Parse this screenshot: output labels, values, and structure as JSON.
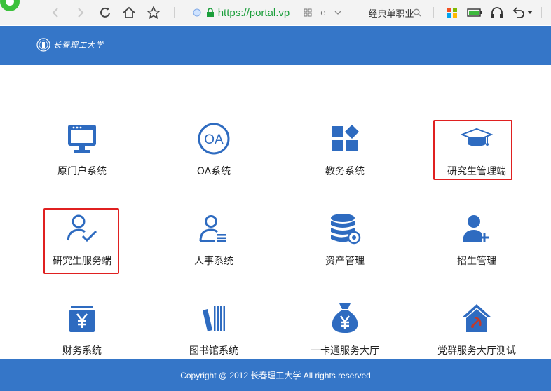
{
  "browser": {
    "url": "https://portal.vp",
    "search_text": "经典单职业"
  },
  "header": {
    "brand_name": "长春理工大学"
  },
  "tiles": [
    {
      "label": "原门户系统",
      "icon": "monitor-icon"
    },
    {
      "label": "OA系统",
      "icon": "oa-circle-icon"
    },
    {
      "label": "教务系统",
      "icon": "grid-blocks-icon"
    },
    {
      "label": "研究生管理端",
      "icon": "graduation-cap-icon",
      "highlighted": true
    },
    {
      "label": "研究生服务端",
      "icon": "user-check-icon",
      "highlighted": true
    },
    {
      "label": "人事系统",
      "icon": "user-list-icon"
    },
    {
      "label": "资产管理",
      "icon": "database-gear-icon"
    },
    {
      "label": "招生管理",
      "icon": "user-plus-icon"
    },
    {
      "label": "财务系统",
      "icon": "yen-box-icon"
    },
    {
      "label": "图书馆系统",
      "icon": "books-icon"
    },
    {
      "label": "一卡通服务大厅",
      "icon": "money-bag-icon"
    },
    {
      "label": "党群服务大厅测试",
      "icon": "party-house-icon"
    }
  ],
  "footer": {
    "copyright": "Copyright @ 2012 长春理工大学 All rights reserved"
  },
  "colors": {
    "brand_blue": "#3576c8",
    "icon_blue": "#2e6bc0",
    "highlight_red": "#e02020",
    "url_green": "#1a9e3a"
  }
}
